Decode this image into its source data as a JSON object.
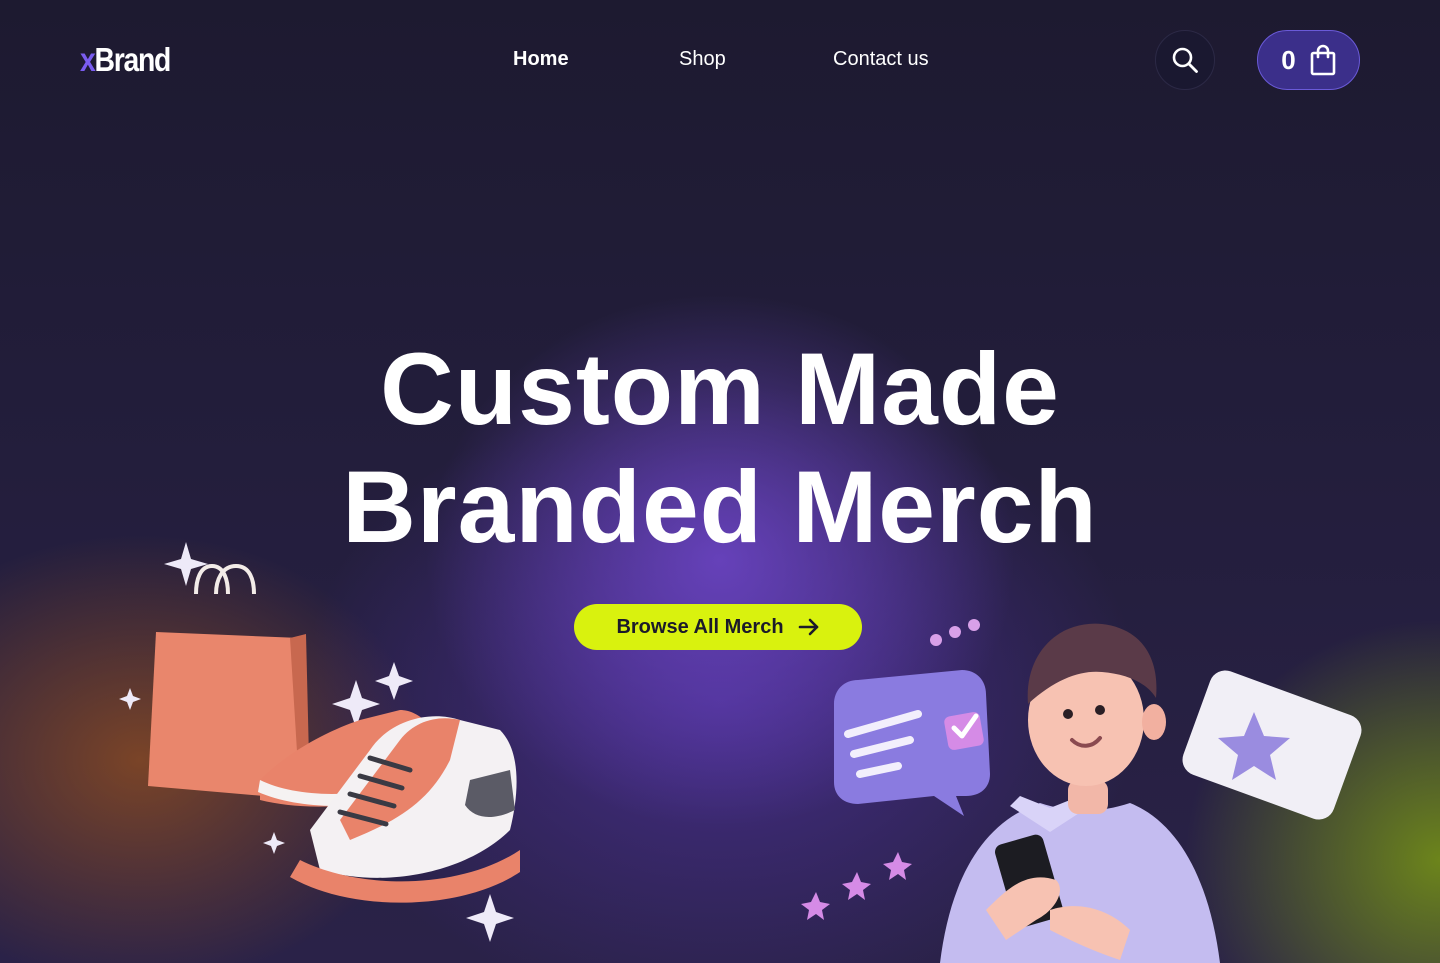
{
  "brand": {
    "logo_x": "x",
    "logo_rest": "Brand"
  },
  "nav": {
    "items": [
      {
        "label": "Home",
        "active": true
      },
      {
        "label": "Shop",
        "active": false
      },
      {
        "label": "Contact us",
        "active": false
      }
    ]
  },
  "header": {
    "search_icon": "search-icon",
    "cart": {
      "count": "0",
      "icon": "shopping-bag-icon"
    }
  },
  "hero": {
    "title_line1": "Custom Made",
    "title_line2": "Branded Merch",
    "cta_label": "Browse All Merch",
    "cta_icon": "arrow-right-icon"
  },
  "colors": {
    "accent": "#d9f20e",
    "brand_purple": "#7a5cf0",
    "cart_bg": "#3b2f8a",
    "background": "#1e1b33"
  }
}
